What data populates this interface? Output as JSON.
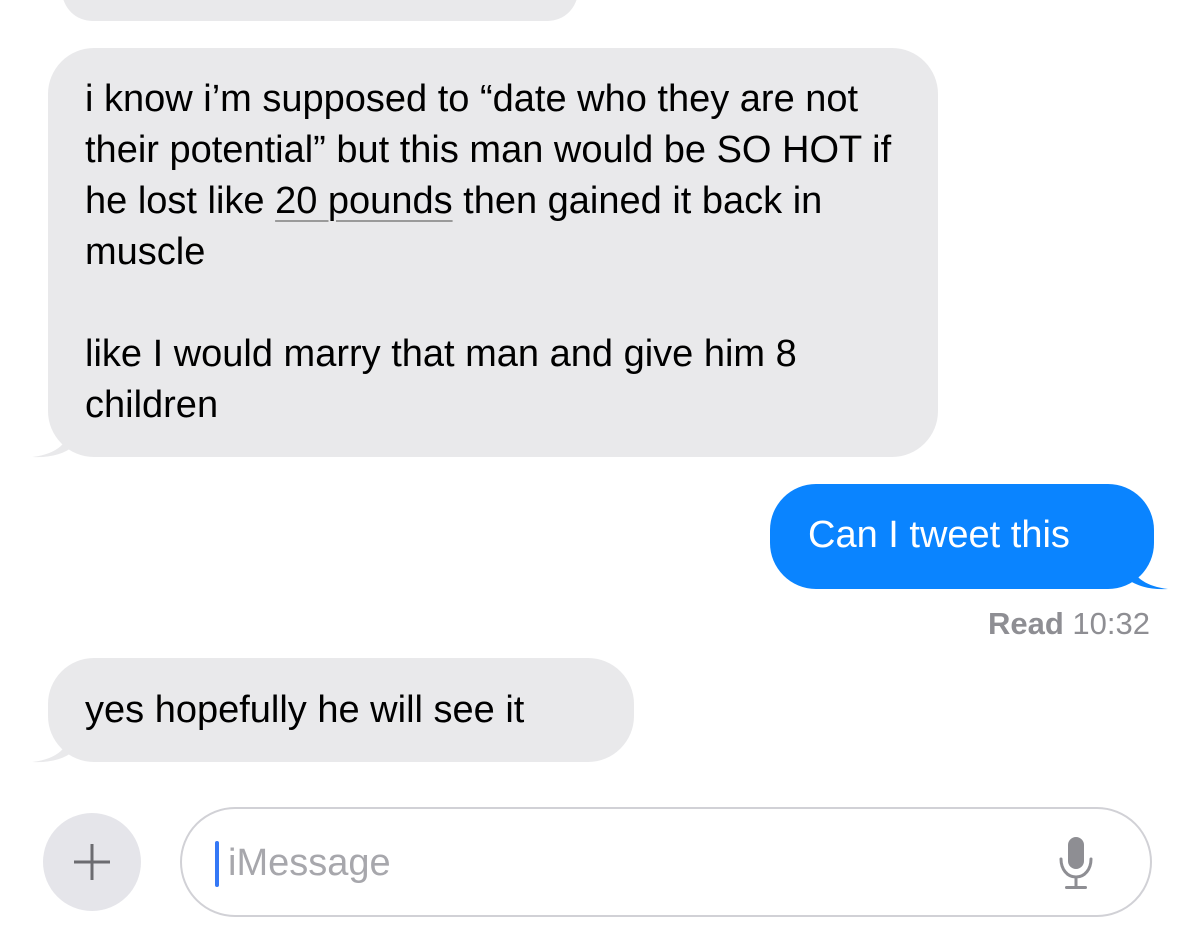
{
  "conversation": {
    "messages": [
      {
        "direction": "incoming",
        "paragraphs": [
          {
            "before": "i know i’m supposed to “date who they are not their potential” but this man would be SO HOT if he lost like ",
            "underlined": "20 pounds",
            "after": " then gained it back in muscle"
          },
          {
            "text": "like I would marry that man and give him 8 children"
          }
        ]
      },
      {
        "direction": "outgoing",
        "text": "Can I tweet this"
      },
      {
        "direction": "incoming",
        "text": "yes hopefully he will see it"
      }
    ],
    "read_receipt": {
      "label": "Read",
      "time": "10:32"
    }
  },
  "compose": {
    "placeholder": "iMessage",
    "value": "",
    "plus_icon": "plus-icon",
    "mic_icon": "microphone-icon"
  },
  "colors": {
    "incoming_bubble": "#e9e9eb",
    "outgoing_bubble": "#0a84ff",
    "caret": "#3478f6",
    "muted_text": "#8e8e93"
  }
}
